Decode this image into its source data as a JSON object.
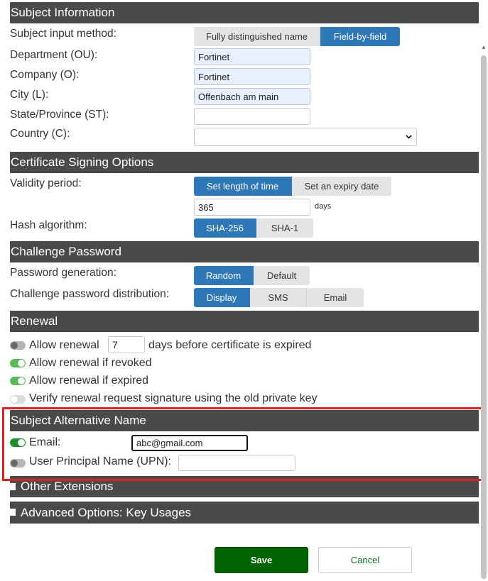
{
  "subject_info": {
    "title": "Subject Information",
    "input_method_label": "Subject input method:",
    "input_method_options": [
      "Fully distinguished name",
      "Field-by-field"
    ],
    "department_label": "Department (OU):",
    "department_value": "Fortinet",
    "company_label": "Company (O):",
    "company_value": "Fortinet",
    "city_label": "City (L):",
    "city_value": "Offenbach am main",
    "state_label": "State/Province (ST):",
    "state_value": "",
    "country_label": "Country (C):",
    "country_value": ""
  },
  "signing": {
    "title": "Certificate Signing Options",
    "validity_label": "Validity period:",
    "validity_options": [
      "Set length of time",
      "Set an expiry date"
    ],
    "days_value": "365",
    "days_unit": "days",
    "hash_label": "Hash algorithm:",
    "hash_options": [
      "SHA-256",
      "SHA-1"
    ]
  },
  "challenge": {
    "title": "Challenge Password",
    "generation_label": "Password generation:",
    "generation_options": [
      "Random",
      "Default"
    ],
    "distribution_label": "Challenge password distribution:",
    "distribution_options": [
      "Display",
      "SMS",
      "Email"
    ]
  },
  "renewal": {
    "title": "Renewal",
    "allow_renewal_label": "Allow renewal",
    "allow_renewal_days": "7",
    "allow_renewal_suffix": "days before certificate is expired",
    "revoked_label": "Allow renewal if revoked",
    "expired_label": "Allow renewal if expired",
    "verify_label": "Verify renewal request signature using the old private key"
  },
  "san": {
    "title": "Subject Alternative Name",
    "email_label": "Email:",
    "email_value": "abc@gmail.com",
    "upn_label": "User Principal Name (UPN):",
    "upn_value": ""
  },
  "other_extensions": {
    "title": "Other Extensions"
  },
  "advanced": {
    "title": "Advanced Options: Key Usages"
  },
  "actions": {
    "save_label": "Save",
    "cancel_label": "Cancel"
  },
  "colors": {
    "section_header": "#4a4a4a",
    "active_option": "#2f78b7",
    "save_button": "#006400",
    "highlight_box": "#e02020",
    "toggle_on": "#5cb85c"
  }
}
